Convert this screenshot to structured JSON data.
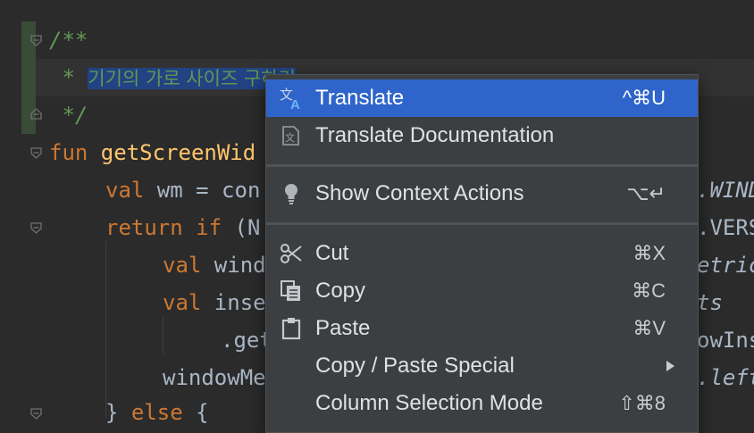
{
  "editor": {
    "lines": [
      {
        "doc": "/**"
      },
      {
        "doc": " * ",
        "selected": "기기의 가로 사이즈 구하기"
      },
      {
        "doc": " */"
      },
      {
        "kw": "fun ",
        "fn": "getScreenWid"
      },
      {
        "kw": "val ",
        "rest": "wm = con"
      },
      {
        "kw": "return if ",
        "rest": "(N"
      },
      {
        "kw": "val ",
        "rest": "wind"
      },
      {
        "kw": "val ",
        "rest": "inse"
      },
      {
        "rest": ".get"
      },
      {
        "rest": "windowMe"
      },
      {
        "rest": "} ",
        "kw": "else ",
        "rest2": "{"
      }
    ],
    "right_fragments": [
      {
        "text": ".WIND",
        "style": "purple"
      },
      {
        "text": ".VERS",
        "style": "plain"
      },
      {
        "text": "etric",
        "style": "purple"
      },
      {
        "text": "ts",
        "style": "purple"
      },
      {
        "text": "owIns",
        "style": "plain"
      },
      {
        "text": ".left",
        "style": "purple"
      }
    ]
  },
  "menu": {
    "items": [
      {
        "id": "translate",
        "label": "Translate",
        "shortcut": "^⌘U",
        "icon": "translate-icon",
        "selected": true
      },
      {
        "id": "translate-documentation",
        "label": "Translate Documentation",
        "shortcut": "",
        "icon": "translate-documentation-icon"
      },
      {
        "id": "show-context-actions",
        "label": "Show Context Actions",
        "shortcut": "⌥↵",
        "icon": "lightbulb-icon"
      },
      {
        "id": "cut",
        "label": "Cut",
        "shortcut": "⌘X",
        "icon": "scissors-icon"
      },
      {
        "id": "copy",
        "label": "Copy",
        "shortcut": "⌘C",
        "icon": "copy-icon"
      },
      {
        "id": "paste",
        "label": "Paste",
        "shortcut": "⌘V",
        "icon": "paste-icon"
      },
      {
        "id": "copy-paste-special",
        "label": "Copy / Paste Special",
        "shortcut": "",
        "submenu": true
      },
      {
        "id": "column-selection-mode",
        "label": "Column Selection Mode",
        "shortcut": "⇧⌘8"
      }
    ]
  },
  "colors": {
    "background": "#2b2b2b",
    "menu_background": "#3c3f41",
    "menu_selection": "#2f65ca",
    "keyword": "#cc7832",
    "function": "#ffc66d",
    "doc_comment": "#629755",
    "text_selection": "#214283"
  }
}
